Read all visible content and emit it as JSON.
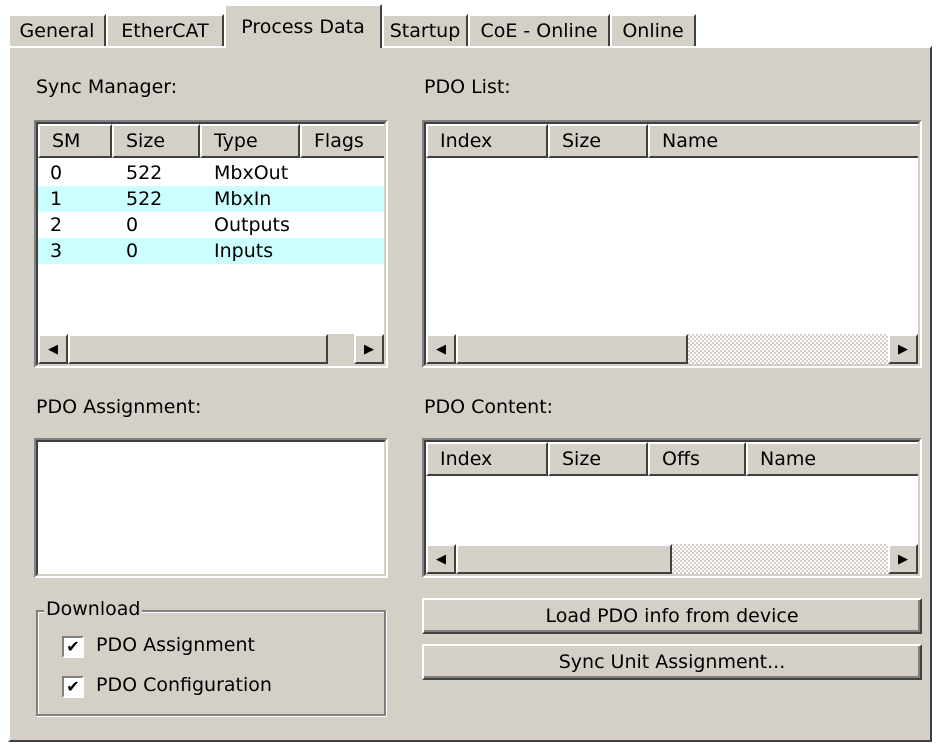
{
  "tabs": [
    {
      "label": "General"
    },
    {
      "label": "EtherCAT"
    },
    {
      "label": "Process Data"
    },
    {
      "label": "Startup"
    },
    {
      "label": "CoE - Online"
    },
    {
      "label": "Online"
    }
  ],
  "active_tab": "Process Data",
  "sync_manager": {
    "label": "Sync Manager:",
    "columns": [
      "SM",
      "Size",
      "Type",
      "Flags"
    ],
    "rows": [
      {
        "sm": "0",
        "size": "522",
        "type": "MbxOut",
        "flags": ""
      },
      {
        "sm": "1",
        "size": "522",
        "type": "MbxIn",
        "flags": ""
      },
      {
        "sm": "2",
        "size": "0",
        "type": "Outputs",
        "flags": ""
      },
      {
        "sm": "3",
        "size": "0",
        "type": "Inputs",
        "flags": ""
      }
    ],
    "highlight_color": "#ccffff"
  },
  "pdo_list": {
    "label": "PDO List:",
    "columns": [
      "Index",
      "Size",
      "Name"
    ]
  },
  "pdo_assignment": {
    "label": "PDO Assignment:"
  },
  "pdo_content": {
    "label": "PDO Content:",
    "columns": [
      "Index",
      "Size",
      "Offs",
      "Name"
    ]
  },
  "download": {
    "label": "Download",
    "pdo_assignment": {
      "label": "PDO Assignment",
      "checked": true
    },
    "pdo_configuration": {
      "label": "PDO Configuration",
      "checked": true
    }
  },
  "buttons": {
    "load_pdo": "Load PDO info from device",
    "sync_unit": "Sync Unit Assignment..."
  },
  "icons": {
    "scroll_left": "arrow-left-icon",
    "scroll_right": "arrow-right-icon",
    "checkmark": "checkmark-icon"
  }
}
